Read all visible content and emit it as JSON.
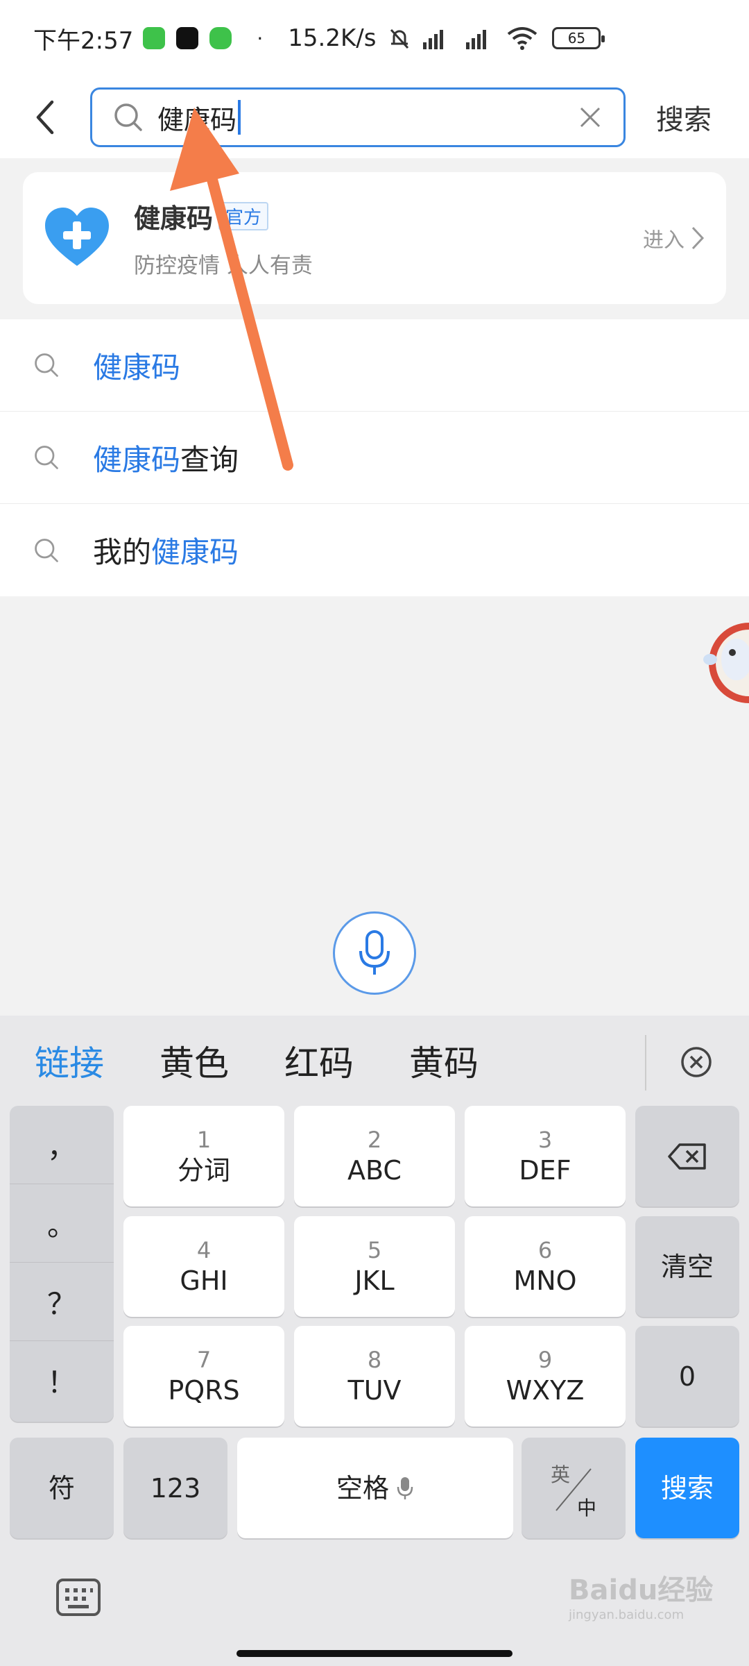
{
  "status_bar": {
    "time": "下午2:57",
    "dot": "·",
    "net_speed": "15.2K/s",
    "battery": "65"
  },
  "search": {
    "query": "健康码",
    "submit_label": "搜索"
  },
  "result_card": {
    "title": "健康码",
    "badge": "官方",
    "subtitle": "防控疫情 人人有责",
    "action": "进入"
  },
  "suggestions": [
    {
      "pre": "",
      "hl": "健康码",
      "post": ""
    },
    {
      "pre": "",
      "hl": "健康码",
      "post": "查询"
    },
    {
      "pre": "我的",
      "hl": "健康码",
      "post": ""
    }
  ],
  "keyboard": {
    "candidates": [
      "链接",
      "黄色",
      "红码",
      "黄码"
    ],
    "punctuation": [
      "，",
      "。",
      "？",
      "！"
    ],
    "keys": {
      "k1_num": "1",
      "k1_lbl": "分词",
      "k2_num": "2",
      "k2_lbl": "ABC",
      "k3_num": "3",
      "k3_lbl": "DEF",
      "k4_num": "4",
      "k4_lbl": "GHI",
      "k5_num": "5",
      "k5_lbl": "JKL",
      "k6_num": "6",
      "k6_lbl": "MNO",
      "k7_num": "7",
      "k7_lbl": "PQRS",
      "k8_num": "8",
      "k8_lbl": "TUV",
      "k9_num": "9",
      "k9_lbl": "WXYZ",
      "clear": "清空",
      "zero": "0",
      "symbol": "符",
      "num123": "123",
      "space": "空格",
      "lang_en": "英",
      "lang_zh": "中",
      "enter": "搜索"
    }
  },
  "watermark": {
    "brand": "Baidu经验",
    "url": "jingyan.baidu.com"
  }
}
